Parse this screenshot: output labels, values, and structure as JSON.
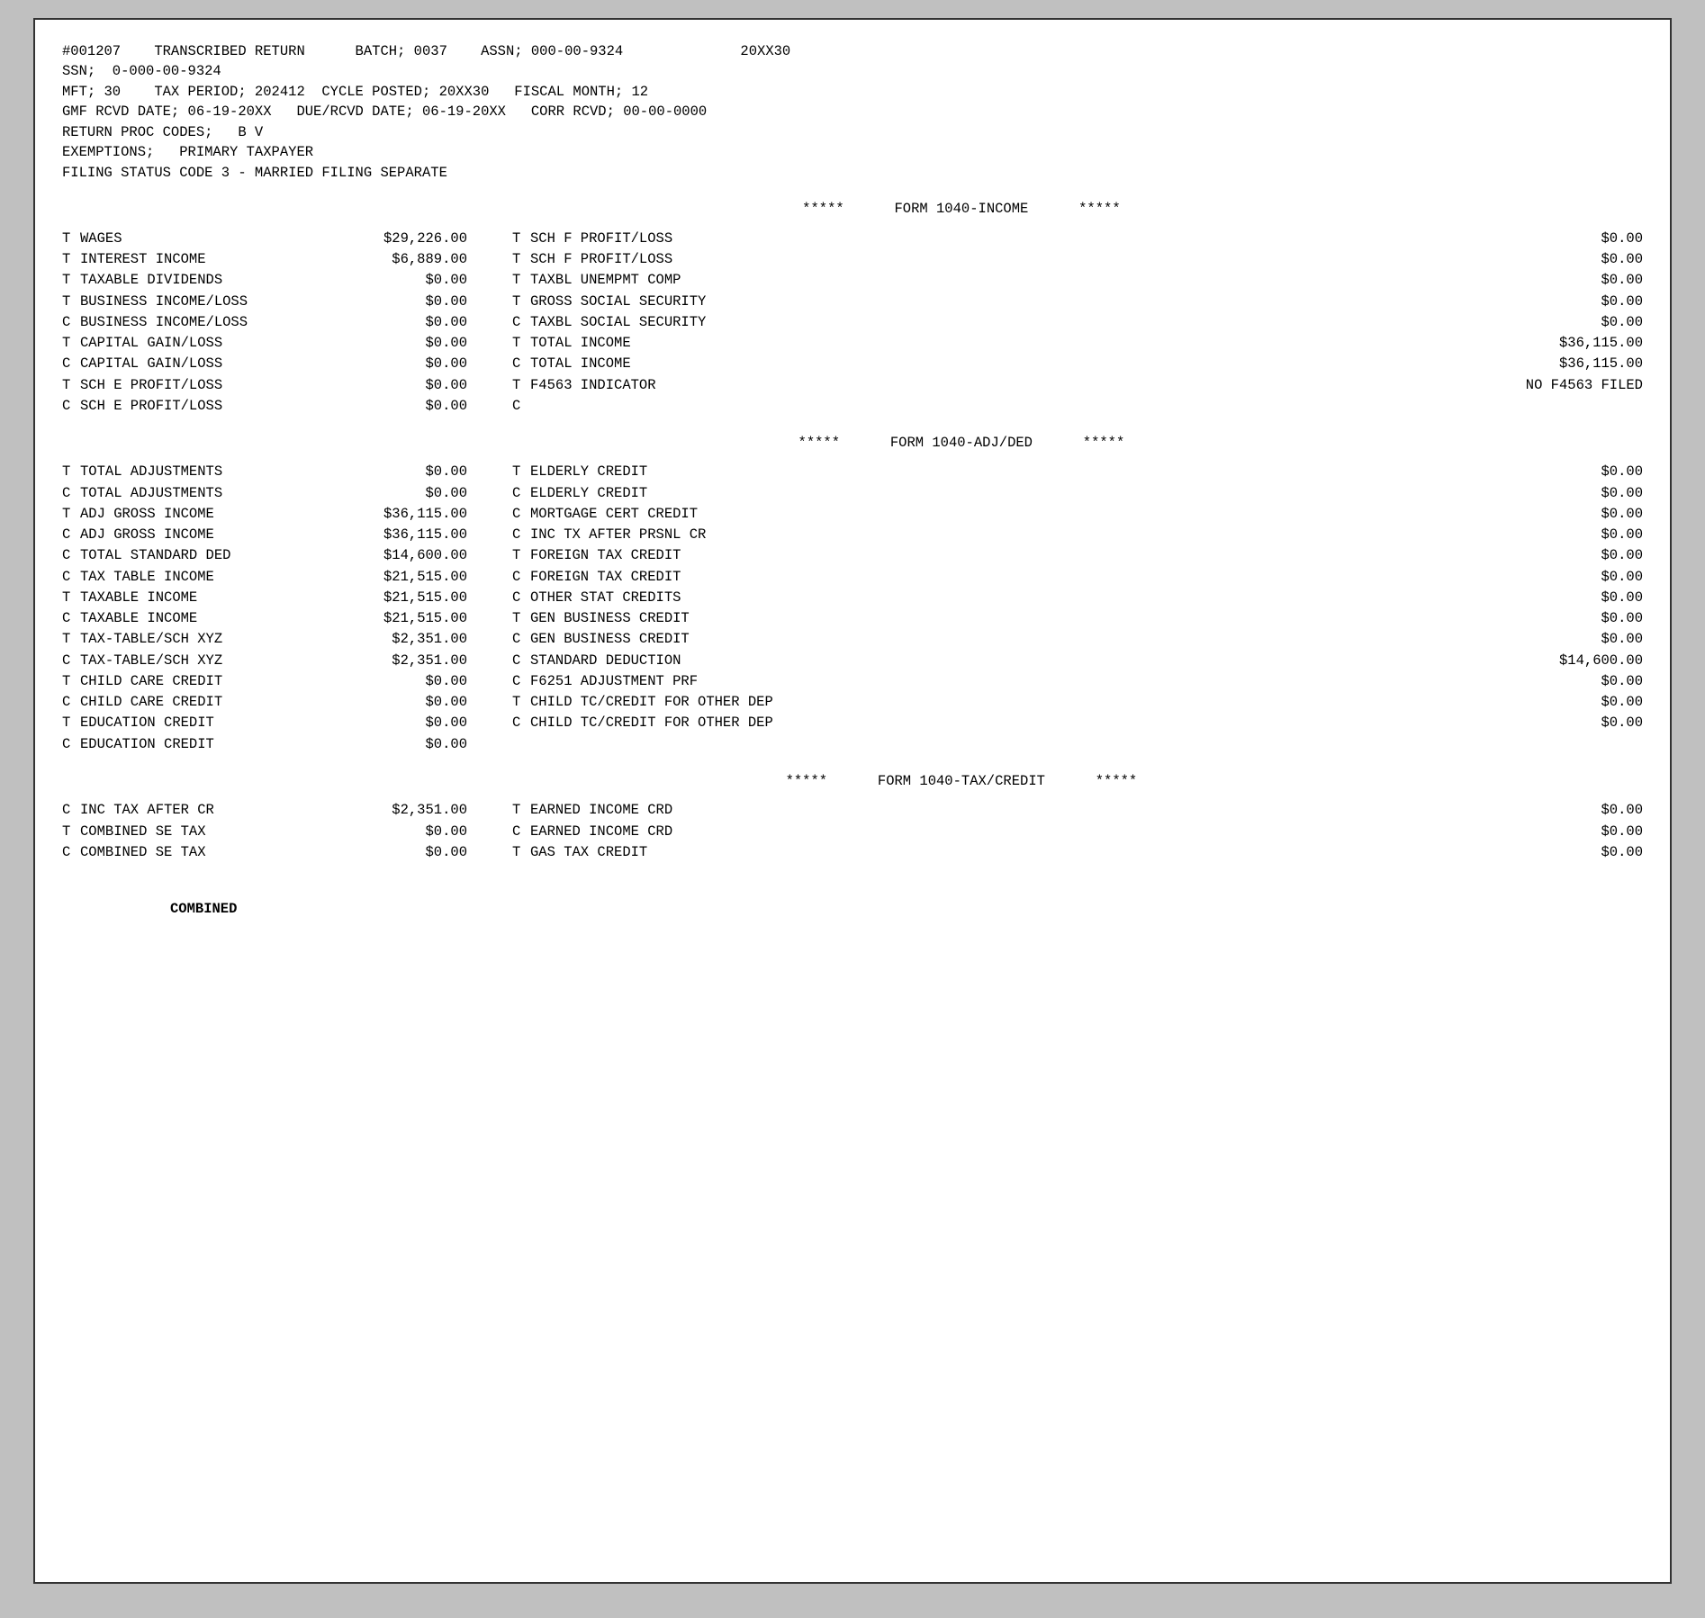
{
  "header": {
    "line1": "#001207    TRANSCRIBED RETURN      BATCH; 0037    ASSN; 000-00-9324              20XX30",
    "line2": "SSN;  0-000-00-9324",
    "line3": "MFT; 30    TAX PERIOD; 202412  CYCLE POSTED; 20XX30   FISCAL MONTH; 12",
    "line4": "GMF RCVD DATE; 06-19-20XX   DUE/RCVD DATE; 06-19-20XX   CORR RCVD; 00-00-0000",
    "line5": "RETURN PROC CODES;   B V",
    "line6": "EXEMPTIONS;   PRIMARY TAXPAYER",
    "line7": "FILING STATUS CODE 3 - MARRIED FILING SEPARATE"
  },
  "income_section": {
    "title": "                          *****      FORM 1040-INCOME      *****",
    "rows": [
      {
        "tc1": "T",
        "label1": "WAGES",
        "val1": "$29,226.00",
        "tc2": "T",
        "label2": "SCH F PROFIT/LOSS",
        "val2": "$0.00"
      },
      {
        "tc1": "T",
        "label1": "INTEREST INCOME",
        "val1": "$6,889.00",
        "tc2": "T",
        "label2": "SCH F PROFIT/LOSS",
        "val2": "$0.00"
      },
      {
        "tc1": "T",
        "label1": "TAXABLE DIVIDENDS",
        "val1": "$0.00",
        "tc2": "T",
        "label2": "TAXBL UNEMPMT COMP",
        "val2": "$0.00"
      },
      {
        "tc1": "T",
        "label1": "BUSINESS INCOME/LOSS",
        "val1": "$0.00",
        "tc2": "T",
        "label2": "GROSS SOCIAL SECURITY",
        "val2": "$0.00"
      },
      {
        "tc1": "C",
        "label1": "BUSINESS INCOME/LOSS",
        "val1": "$0.00",
        "tc2": "C",
        "label2": "TAXBL SOCIAL SECURITY",
        "val2": "$0.00"
      },
      {
        "tc1": "T",
        "label1": "CAPITAL GAIN/LOSS",
        "val1": "$0.00",
        "tc2": "T",
        "label2": "TOTAL INCOME",
        "val2": "$36,115.00"
      },
      {
        "tc1": "C",
        "label1": "CAPITAL GAIN/LOSS",
        "val1": "$0.00",
        "tc2": "C",
        "label2": "TOTAL INCOME",
        "val2": "$36,115.00"
      },
      {
        "tc1": "T",
        "label1": "SCH E PROFIT/LOSS",
        "val1": "$0.00",
        "tc2": "T",
        "label2": "F4563 INDICATOR",
        "val2": "NO F4563 FILED"
      },
      {
        "tc1": "C",
        "label1": "SCH E PROFIT/LOSS",
        "val1": "$0.00",
        "tc2": "C",
        "label2": "",
        "val2": ""
      }
    ]
  },
  "adjded_section": {
    "title": "                          *****      FORM 1040-ADJ/DED      *****",
    "rows": [
      {
        "tc1": "T",
        "label1": "TOTAL ADJUSTMENTS",
        "val1": "$0.00",
        "tc2": "T",
        "label2": "ELDERLY CREDIT",
        "val2": "$0.00"
      },
      {
        "tc1": "C",
        "label1": "TOTAL ADJUSTMENTS",
        "val1": "$0.00",
        "tc2": "C",
        "label2": "ELDERLY CREDIT",
        "val2": "$0.00"
      },
      {
        "tc1": "T",
        "label1": "ADJ GROSS INCOME",
        "val1": "$36,115.00",
        "tc2": "C",
        "label2": "MORTGAGE CERT CREDIT",
        "val2": "$0.00"
      },
      {
        "tc1": "C",
        "label1": "ADJ GROSS INCOME",
        "val1": "$36,115.00",
        "tc2": "C",
        "label2": "INC TX AFTER PRSNL CR",
        "val2": "$0.00"
      },
      {
        "tc1": "C",
        "label1": "TOTAL STANDARD DED",
        "val1": "$14,600.00",
        "tc2": "T",
        "label2": "FOREIGN TAX CREDIT",
        "val2": "$0.00"
      },
      {
        "tc1": "C",
        "label1": "TAX TABLE INCOME",
        "val1": "$21,515.00",
        "tc2": "C",
        "label2": "FOREIGN TAX CREDIT",
        "val2": "$0.00"
      },
      {
        "tc1": "T",
        "label1": "TAXABLE INCOME",
        "val1": "$21,515.00",
        "tc2": "C",
        "label2": "OTHER STAT CREDITS",
        "val2": "$0.00"
      },
      {
        "tc1": "C",
        "label1": "TAXABLE INCOME",
        "val1": "$21,515.00",
        "tc2": "T",
        "label2": "GEN BUSINESS CREDIT",
        "val2": "$0.00"
      },
      {
        "tc1": "T",
        "label1": "TAX-TABLE/SCH XYZ",
        "val1": "$2,351.00",
        "tc2": "C",
        "label2": "GEN BUSINESS CREDIT",
        "val2": "$0.00"
      },
      {
        "tc1": "C",
        "label1": "TAX-TABLE/SCH XYZ",
        "val1": "$2,351.00",
        "tc2": "C",
        "label2": "STANDARD DEDUCTION",
        "val2": "$14,600.00"
      },
      {
        "tc1": "T",
        "label1": "CHILD CARE CREDIT",
        "val1": "$0.00",
        "tc2": "C",
        "label2": "F6251 ADJUSTMENT PRF",
        "val2": "$0.00"
      },
      {
        "tc1": "C",
        "label1": "CHILD CARE CREDIT",
        "val1": "$0.00",
        "tc2": "T",
        "label2": "CHILD TC/CREDIT FOR OTHER DEP",
        "val2": "$0.00"
      },
      {
        "tc1": "T",
        "label1": "EDUCATION CREDIT",
        "val1": "$0.00",
        "tc2": "C",
        "label2": "CHILD TC/CREDIT FOR OTHER DEP",
        "val2": "$0.00"
      },
      {
        "tc1": "C",
        "label1": "EDUCATION CREDIT",
        "val1": "$0.00",
        "tc2": "",
        "label2": "",
        "val2": ""
      }
    ]
  },
  "taxcredit_section": {
    "title": "                          *****      FORM 1040-TAX/CREDIT      *****",
    "rows": [
      {
        "tc1": "C",
        "label1": "INC TAX AFTER CR",
        "val1": "$2,351.00",
        "tc2": "T",
        "label2": "EARNED INCOME CRD",
        "val2": "$0.00"
      },
      {
        "tc1": "T",
        "label1": "COMBINED SE TAX",
        "val1": "$0.00",
        "tc2": "C",
        "label2": "EARNED INCOME CRD",
        "val2": "$0.00"
      },
      {
        "tc1": "C",
        "label1": "COMBINED SE TAX",
        "val1": "$0.00",
        "tc2": "T",
        "label2": "GAS TAX CREDIT",
        "val2": "$0.00"
      }
    ]
  },
  "footer": {
    "combined_label": "COMBINED"
  }
}
